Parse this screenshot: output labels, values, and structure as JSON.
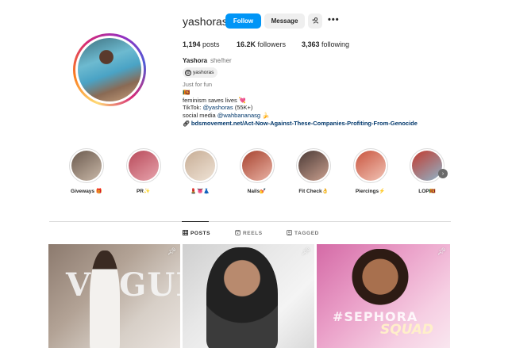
{
  "profile": {
    "username": "yashoras",
    "full_name": "Yashora",
    "pronouns": "she/her",
    "threads_handle": "yashoras",
    "buttons": {
      "follow": "Follow",
      "message": "Message",
      "add_user": "+A"
    },
    "more_icon": "•••"
  },
  "stats": {
    "posts_value": "1,194",
    "posts_label": " posts",
    "followers_value": "16.2K",
    "followers_label": " followers",
    "following_value": "3,363",
    "following_label": " following"
  },
  "bio": {
    "category": "Just for fun",
    "line1": "🇱🇰",
    "line2": "feminism saves lives 💘",
    "line3_prefix": "TikTok: ",
    "line3_mention": "@yashoras",
    "line3_suffix": " (55K+)",
    "line4_prefix": "social media ",
    "line4_mention": "@wahbananasg",
    "line4_suffix": " 🍌",
    "link": "bdsmovement.net/Act-Now-Against-These-Companies-Profiting-From-Genocide"
  },
  "highlights": [
    {
      "label": "Giveways 🎁",
      "color_a": "#6b5a4e",
      "color_b": "#c9b8a8"
    },
    {
      "label": "PR✨",
      "color_a": "#b84a5a",
      "color_b": "#e7a3ac"
    },
    {
      "label": "💄👅👗",
      "color_a": "#c7ad95",
      "color_b": "#efe3d6"
    },
    {
      "label": "Nails💅",
      "color_a": "#a7432f",
      "color_b": "#e9b2a4"
    },
    {
      "label": "Fit Check👌",
      "color_a": "#4b3a36",
      "color_b": "#c99f8e"
    },
    {
      "label": "Piercings⚡",
      "color_a": "#c9553f",
      "color_b": "#f1c3b5"
    },
    {
      "label": "LOP🇱🇰",
      "color_a": "#c23b2f",
      "color_b": "#8fb4c9"
    }
  ],
  "tabs": [
    {
      "label": "POSTS",
      "icon": "grid-icon",
      "active": true
    },
    {
      "label": "REELS",
      "icon": "reels-icon",
      "active": false
    },
    {
      "label": "TAGGED",
      "icon": "tagged-icon",
      "active": false
    }
  ],
  "posts": [
    {
      "overlay_text": "VOGUE",
      "pinned": true
    },
    {
      "overlay_text": "",
      "pinned": true
    },
    {
      "overlay_text": "#SEPHORA",
      "overlay_text_2": "SQUAD",
      "pinned": true
    }
  ],
  "colors": {
    "accent": "#0095f6",
    "link": "#00376b",
    "muted": "#737373"
  }
}
